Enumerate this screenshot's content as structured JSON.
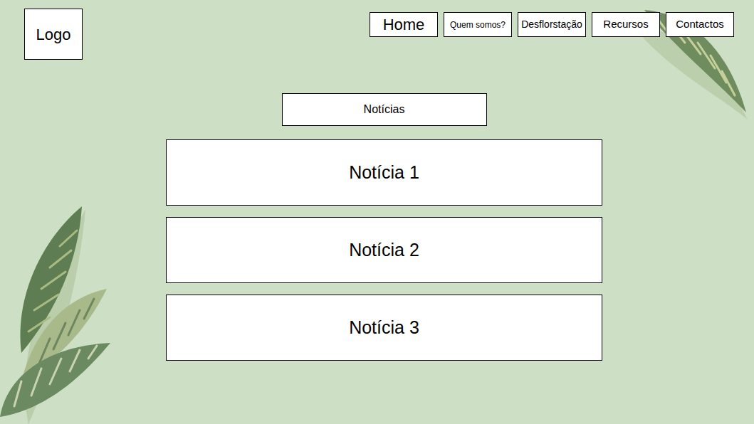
{
  "logo": {
    "label": "Logo"
  },
  "nav": [
    {
      "label": "Home"
    },
    {
      "label": "Quem somos?"
    },
    {
      "label": "Desflorstação"
    },
    {
      "label": "Recursos"
    },
    {
      "label": "Contactos"
    }
  ],
  "section": {
    "title": "Notícias"
  },
  "news": [
    {
      "title": "Notícia 1"
    },
    {
      "title": "Notícia 2"
    },
    {
      "title": "Notícia 3"
    }
  ]
}
